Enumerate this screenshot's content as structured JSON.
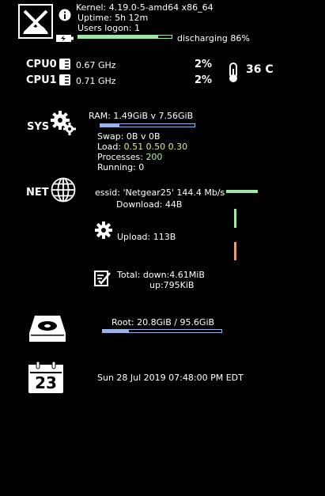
{
  "header": {
    "logo_icon": "xfce-logo",
    "info_icon": "info-icon",
    "kernel": "Kernel: 4.19.0-5-amd64 x86_64",
    "uptime": "Uptime: 5h 12m",
    "users": "Users logon: 1",
    "battery_status": "discharging 86%",
    "battery_fraction": 0.86,
    "battery_icon": "battery-charging-icon"
  },
  "cpu": [
    {
      "label": "CPU0",
      "freq": "0.67 GHz",
      "usage": "2%"
    },
    {
      "label": "CPU1",
      "freq": "0.71 GHz",
      "usage": "2%"
    }
  ],
  "temp": {
    "value": "36 C",
    "icon": "thermometer-icon"
  },
  "sys": {
    "label": "SYS",
    "icon": "gears-icon",
    "ram": "RAM: 1.49GiB v 7.56GiB",
    "ram_fraction": 0.2,
    "swap": "Swap: 0B   v 0B",
    "load_label": "Load:",
    "load_values": "0.51 0.50 0.30",
    "processes_label": "Processes:",
    "processes_value": "200",
    "running": "Running: 0"
  },
  "net": {
    "label": "NET",
    "icon": "globe-icon",
    "essid": "essid: 'Netgear25' 144.4 Mb/s",
    "download": "Download: 44B",
    "upload": "Upload: 113B",
    "upload_icon": "gear-icon",
    "total_icon": "checklist-icon",
    "total_down": "Total:  down:4.61MiB",
    "total_up": "up:795KiB"
  },
  "disk": {
    "icon": "hard-drive-icon",
    "root": "Root: 20.8GiB / 95.6GiB",
    "root_fraction": 0.22
  },
  "calendar": {
    "icon": "calendar-icon",
    "day": "23",
    "datetime": "Sun 28 Jul 2019 07:48:00 PM EDT"
  },
  "colors": {
    "green": "#9ee8a8",
    "blue": "#9ab4e8",
    "orange": "#e89a7a",
    "processes": "#b6f0a8",
    "load": "#d6f08a"
  }
}
